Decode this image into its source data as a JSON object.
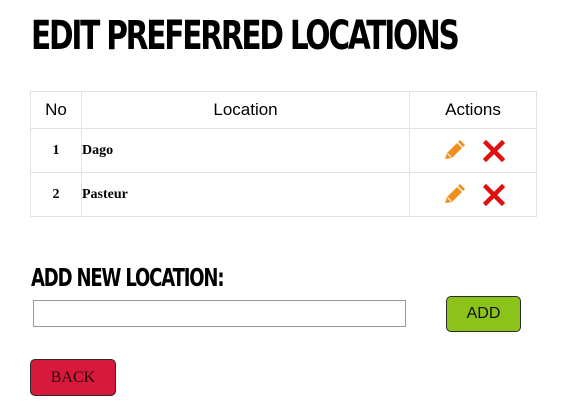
{
  "page": {
    "title": "Edit Preferred Locations"
  },
  "table": {
    "headers": {
      "no": "No",
      "location": "Location",
      "actions": "Actions"
    },
    "rows": [
      {
        "no": "1",
        "location": "Dago"
      },
      {
        "no": "2",
        "location": "Pasteur"
      }
    ],
    "edit_icon": "pencil-icon",
    "delete_icon": "x-icon"
  },
  "add_form": {
    "heading": "Add New Location:",
    "input_value": "",
    "input_placeholder": "",
    "add_label": "ADD"
  },
  "back_label": "BACK",
  "colors": {
    "edit_icon": "#f0901e",
    "delete_icon": "#e01010",
    "add_button": "#8cc31a",
    "back_button": "#d71a3c"
  }
}
